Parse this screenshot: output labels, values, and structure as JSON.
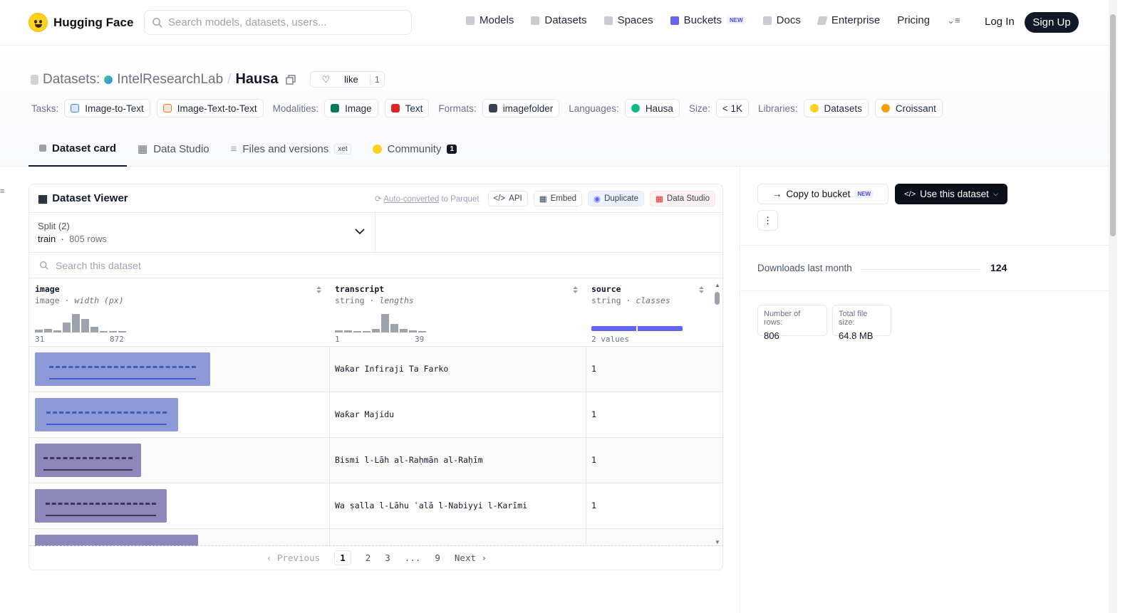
{
  "nav": {
    "brand": "Hugging Face",
    "search_placeholder": "Search models, datasets, users...",
    "links": [
      {
        "label": "Models",
        "icon": "cube-icon"
      },
      {
        "label": "Datasets",
        "icon": "database-icon"
      },
      {
        "label": "Spaces",
        "icon": "grid-icon"
      },
      {
        "label": "Buckets",
        "icon": "bucket-icon",
        "badge": "NEW"
      },
      {
        "label": "Docs",
        "icon": "book-icon"
      },
      {
        "label": "Enterprise",
        "icon": "enterprise-icon"
      },
      {
        "label": "Pricing"
      }
    ],
    "login": "Log In",
    "signup": "Sign Up"
  },
  "header": {
    "prefix": "Datasets:",
    "owner": "IntelResearchLab",
    "separator": "/",
    "name": "Hausa",
    "like_label": "like",
    "like_count": "1"
  },
  "tags": {
    "tasks_label": "Tasks:",
    "tasks": [
      "Image-to-Text",
      "Image-Text-to-Text"
    ],
    "modalities_label": "Modalities:",
    "modalities": [
      "Image",
      "Text"
    ],
    "formats_label": "Formats:",
    "formats": [
      "imagefolder"
    ],
    "languages_label": "Languages:",
    "languages": [
      "Hausa"
    ],
    "size_label": "Size:",
    "size": "< 1K",
    "libraries_label": "Libraries:",
    "libraries": [
      "Datasets",
      "Croissant"
    ]
  },
  "tabs": [
    {
      "label": "Dataset card",
      "active": true
    },
    {
      "label": "Data Studio"
    },
    {
      "label": "Files and versions",
      "badge": "xet"
    },
    {
      "label": "Community",
      "badge": "1"
    }
  ],
  "viewer": {
    "title": "Dataset Viewer",
    "auto_converted": "Auto-converted",
    "to_parquet": " to Parquet",
    "buttons": [
      "API",
      "Embed",
      "Duplicate",
      "Data Studio"
    ],
    "split_label": "Split (2)",
    "split_value": "train",
    "split_rows": "805 rows",
    "search_placeholder": "Search this dataset",
    "columns": [
      {
        "name": "image",
        "type": "image",
        "stat": "width (px)",
        "axis_min": "31",
        "axis_max": "872",
        "hist": [
          0.15,
          0.2,
          0.1,
          0.55,
          1.0,
          0.75,
          0.3,
          0.08,
          0.0,
          0.05
        ]
      },
      {
        "name": "transcript",
        "type": "string",
        "stat": "lengths",
        "axis_min": "1",
        "axis_max": "39",
        "hist": [
          0.1,
          0.1,
          0.05,
          0.05,
          0.2,
          1.0,
          0.45,
          0.2,
          0.1,
          0.05
        ]
      },
      {
        "name": "source",
        "type": "string",
        "stat": "classes",
        "axis_label": "2 values"
      }
    ],
    "rows": [
      {
        "transcript": "Waƙar Infiraji Ta Farko",
        "source": "1"
      },
      {
        "transcript": "Waƙar Majidu",
        "source": "1"
      },
      {
        "transcript": "Bismi l-Lāh al-Raḥmān al-Raḥīm",
        "source": "1"
      },
      {
        "transcript": "Wa ṣalla l-Lāhu ʿalā l-Nabiyyi l-Karīmi",
        "source": "1"
      }
    ],
    "pager": {
      "prev": "Previous",
      "pages": [
        "1",
        "2",
        "3",
        "...",
        "9"
      ],
      "next": "Next"
    }
  },
  "sidebar": {
    "copy_to_bucket": "Copy to bucket",
    "copy_badge": "NEW",
    "use_dataset": "Use this dataset",
    "downloads_label": "Downloads last month",
    "downloads_value": "124",
    "rows_label": "Number of rows:",
    "rows_value": "806",
    "size_label": "Total file size:",
    "size_value": "64.8 MB"
  }
}
